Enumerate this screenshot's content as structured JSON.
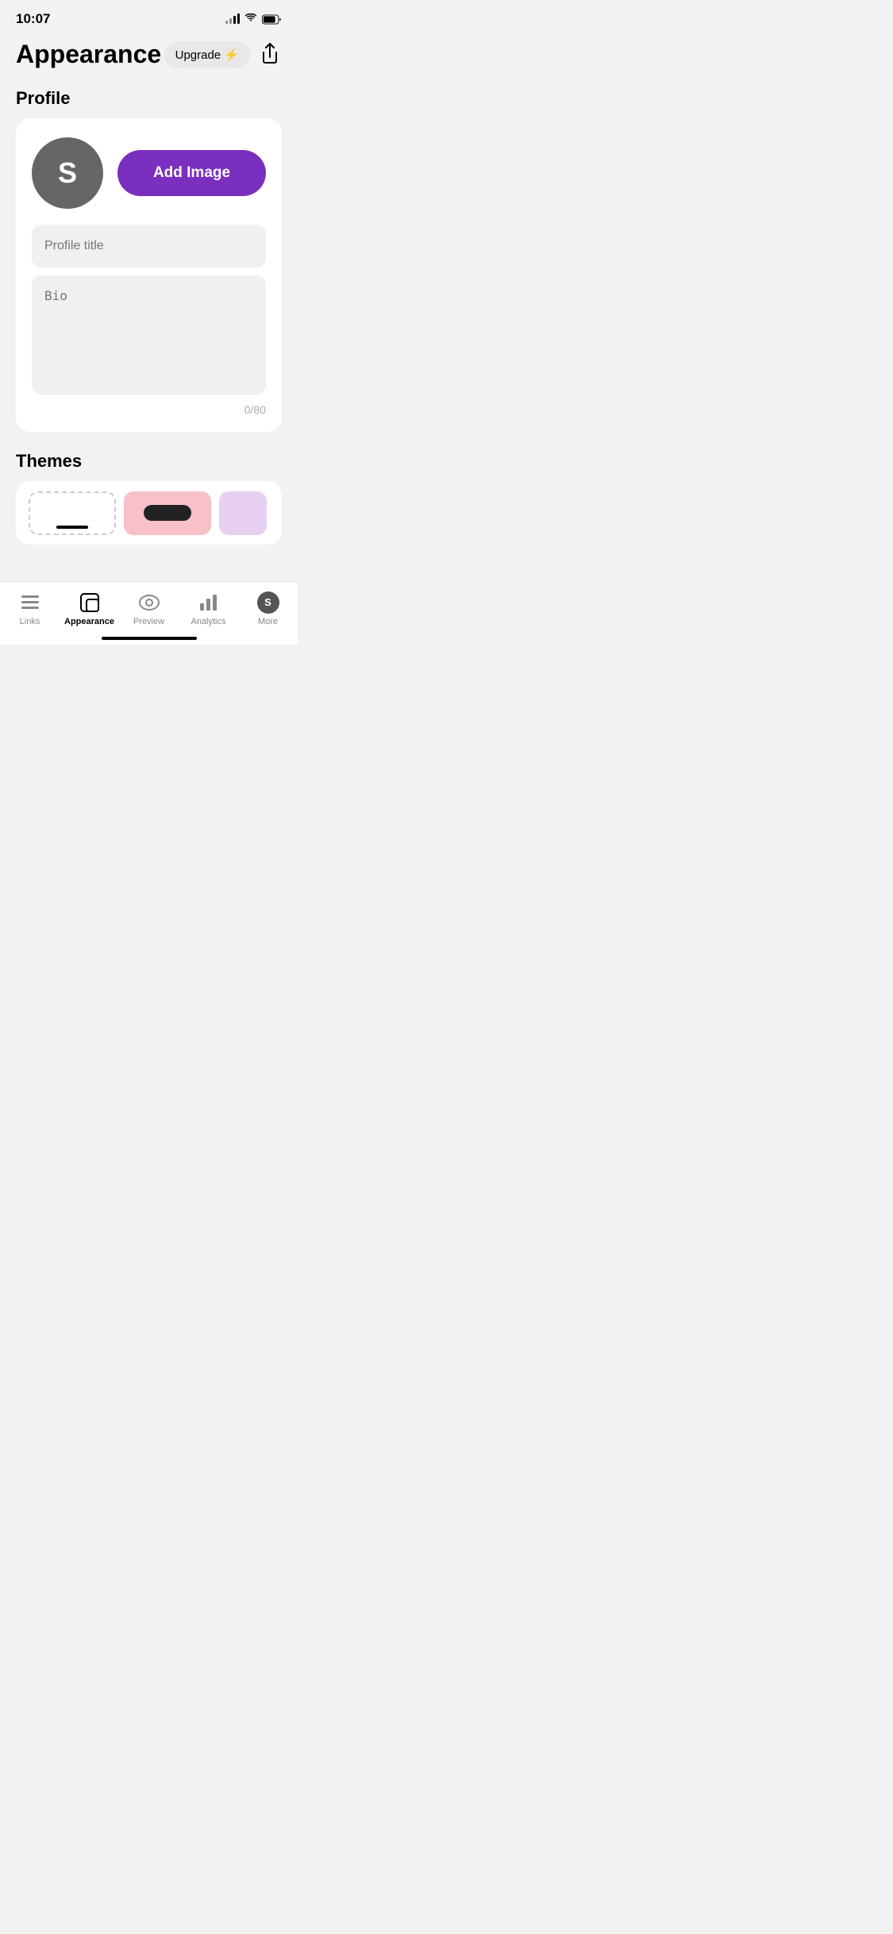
{
  "statusBar": {
    "time": "10:07"
  },
  "header": {
    "title": "Appearance",
    "upgradeLabel": "Upgrade ⚡",
    "shareIcon": "share"
  },
  "profile": {
    "sectionTitle": "Profile",
    "avatarLetter": "S",
    "addImageLabel": "Add Image",
    "profileTitlePlaceholder": "Profile title",
    "bioPlaceholder": "Bio",
    "bioCounter": "0/80"
  },
  "themes": {
    "sectionTitle": "Themes"
  },
  "bottomNav": {
    "items": [
      {
        "id": "links",
        "label": "Links",
        "icon": "links"
      },
      {
        "id": "appearance",
        "label": "Appearance",
        "icon": "appearance",
        "active": true
      },
      {
        "id": "preview",
        "label": "Preview",
        "icon": "preview"
      },
      {
        "id": "analytics",
        "label": "Analytics",
        "icon": "analytics"
      },
      {
        "id": "more",
        "label": "More",
        "icon": "more"
      }
    ]
  }
}
